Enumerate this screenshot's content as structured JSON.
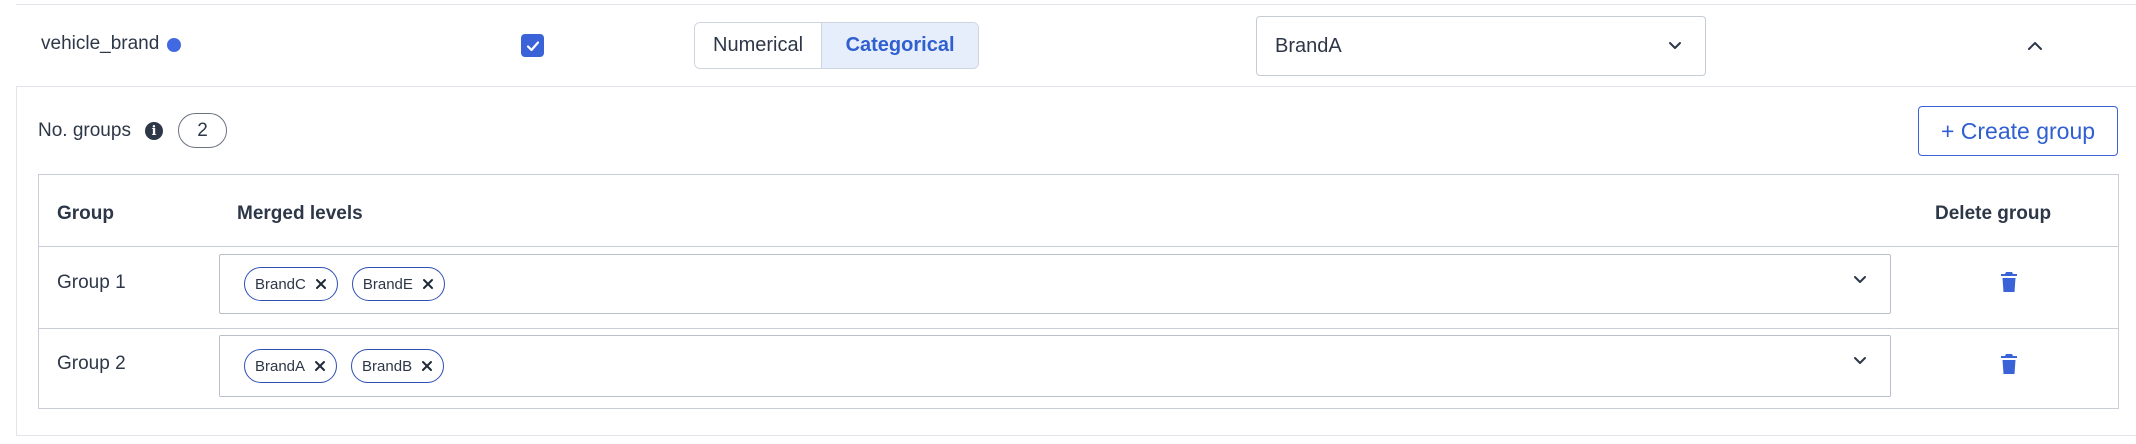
{
  "variable": {
    "name": "vehicle_brand",
    "status_color": "#4169e1",
    "included": true
  },
  "type_toggle": {
    "options": [
      "Numerical",
      "Categorical"
    ],
    "selected": "Categorical"
  },
  "base_level": {
    "value": "BrandA"
  },
  "groups_header": {
    "label": "No. groups",
    "count": "2",
    "create_label": "+ Create group"
  },
  "table": {
    "headers": {
      "group": "Group",
      "merged": "Merged levels",
      "delete": "Delete group"
    },
    "rows": [
      {
        "group": "Group 1",
        "levels": [
          "BrandC",
          "BrandE"
        ]
      },
      {
        "group": "Group 2",
        "levels": [
          "BrandA",
          "BrandB"
        ]
      }
    ]
  },
  "colors": {
    "accent": "#3a63d8",
    "selected_toggle_bg": "#e7eefb",
    "text": "#2d3748"
  },
  "icons": [
    "info-icon",
    "chevron-down-icon",
    "chevron-up-icon",
    "close-icon",
    "trash-icon",
    "check-icon"
  ]
}
